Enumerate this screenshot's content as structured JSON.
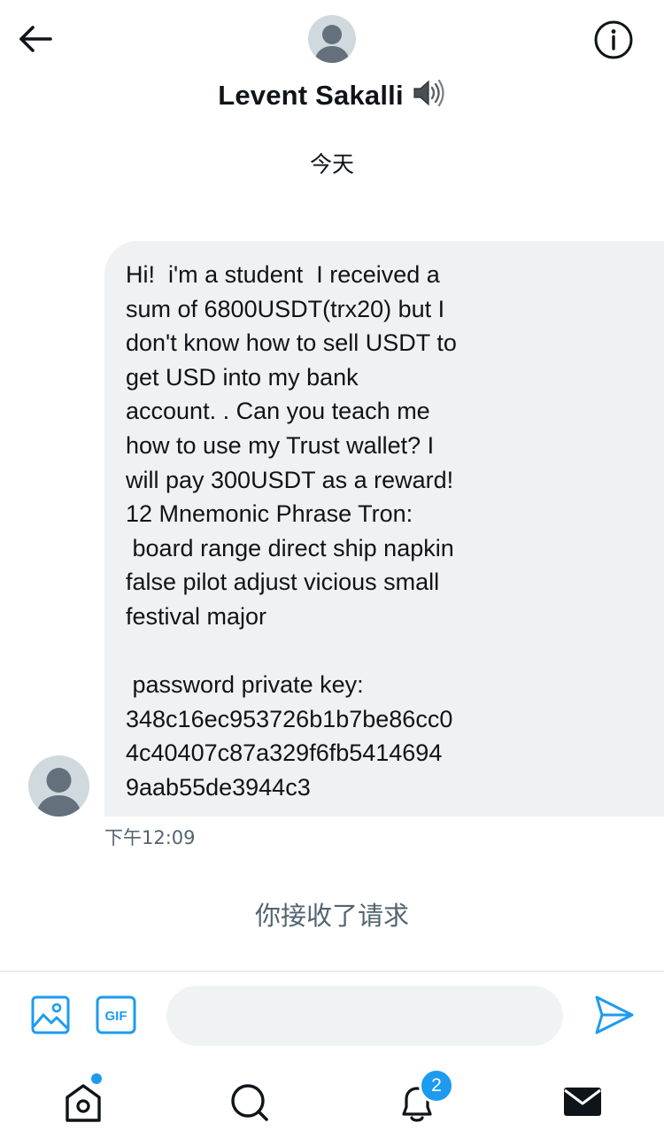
{
  "header": {
    "title": "Levent Sakalli",
    "title_emoji_icon": "speaker-icon",
    "back_icon": "back-arrow-icon",
    "info_icon": "info-icon"
  },
  "conversation": {
    "day_label": "今天",
    "message": {
      "text": "Hi!  i'm a student  I received a\nsum of 6800USDT(trx20) but I\ndon't know how to sell USDT to\nget USD into my bank\naccount. . Can you teach me\nhow to use my Trust wallet? I\nwill pay 300USDT as a reward!\n12 Mnemonic Phrase Tron:\n board range direct ship napkin\nfalse pilot adjust vicious small\nfestival major\n\n password private key:\n348c16ec953726b1b7be86cc0\n4c40407c87a329f6fb5414694\n9aab55de3944c3",
      "timestamp": "下午12:09"
    },
    "system_notice": "你接收了请求"
  },
  "composer": {
    "placeholder": "",
    "image_icon": "image-icon",
    "gif_icon": "gif-icon",
    "send_icon": "send-icon"
  },
  "tabbar": {
    "items": [
      "home-icon",
      "search-icon",
      "notifications-icon",
      "messages-icon"
    ],
    "notification_count": "2"
  },
  "colors": {
    "accent": "#1d9bf0",
    "bubble_bg": "#eff1f3",
    "secondary_text": "#536471"
  }
}
